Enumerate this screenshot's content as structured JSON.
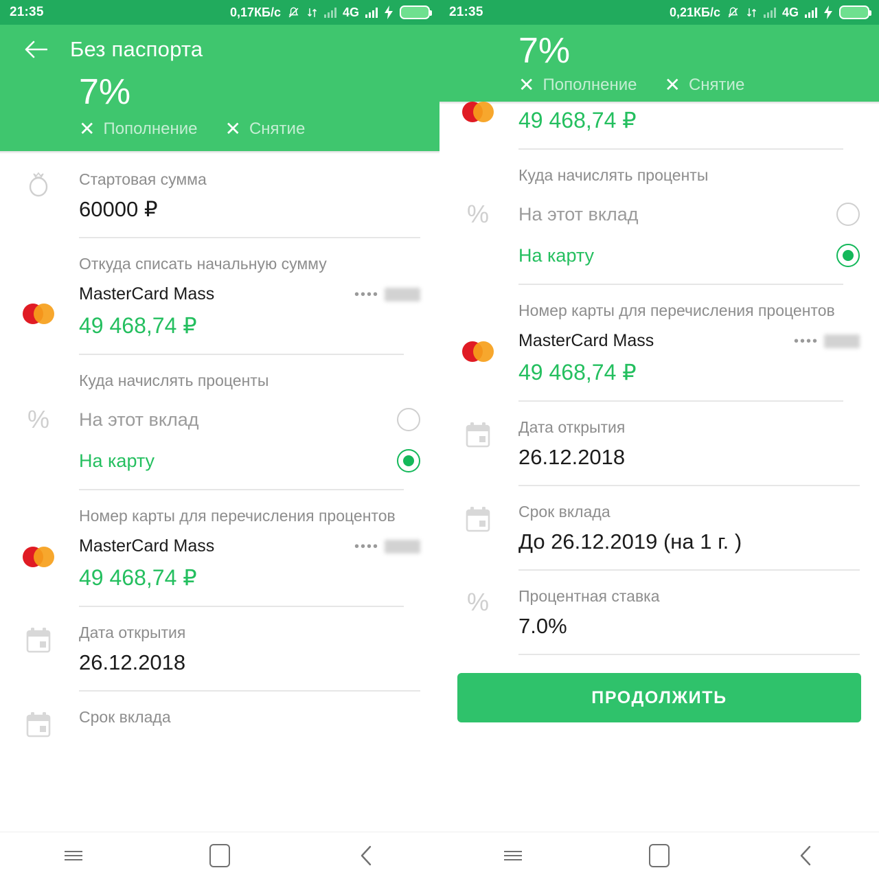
{
  "left": {
    "status": {
      "clock": "21:35",
      "speed": "0,17КБ/с",
      "network": "4G"
    },
    "header": {
      "title": "Без паспорта",
      "rate": "7%",
      "feature_replenish": "Пополнение",
      "feature_withdraw": "Снятие",
      "x_mark": "✕"
    },
    "fields": [
      {
        "label": "Стартовая сумма",
        "value": "60000 ₽"
      },
      {
        "label": "Откуда списать начальную сумму",
        "card_name": "MasterCard Mass",
        "card_dots": "••••",
        "balance": "49 468,74 ₽"
      },
      {
        "label": "Куда начислять проценты",
        "option_deposit": "На этот вклад",
        "option_card": "На карту"
      },
      {
        "label": "Номер карты для перечисления процентов",
        "card_name": "MasterCard Mass",
        "card_dots": "••••",
        "balance": "49 468,74 ₽"
      },
      {
        "label": "Дата открытия",
        "value": "26.12.2018"
      },
      {
        "label": "Срок вклада",
        "value": ""
      }
    ]
  },
  "right": {
    "status": {
      "clock": "21:35",
      "speed": "0,21КБ/с",
      "network": "4G"
    },
    "header": {
      "rate": "7%",
      "feature_replenish": "Пополнение",
      "feature_withdraw": "Снятие",
      "x_mark": "✕"
    },
    "fields": {
      "top_balance": "49 468,74 ₽",
      "interest_label": "Куда начислять проценты",
      "option_deposit": "На этот вклад",
      "option_card": "На карту",
      "card_label": "Номер карты для перечисления процентов",
      "card_name": "MasterCard Mass",
      "card_dots": "••••",
      "card_balance": "49 468,74 ₽",
      "open_date_label": "Дата открытия",
      "open_date_value": "26.12.2018",
      "term_label": "Срок вклада",
      "term_value": "До 26.12.2019 (на 1 г. )",
      "rate_label": "Процентная ставка",
      "rate_value": "7.0%"
    },
    "cta_label": "ПРОДОЛЖИТЬ"
  },
  "colors": {
    "statusbar_green": "#21ab5d",
    "header_green": "#3fc66e",
    "accent_green": "#24bf5f",
    "cta_green": "#2fc26b",
    "mastercard_red": "#e01b24",
    "mastercard_yellow": "#f6a01b"
  }
}
